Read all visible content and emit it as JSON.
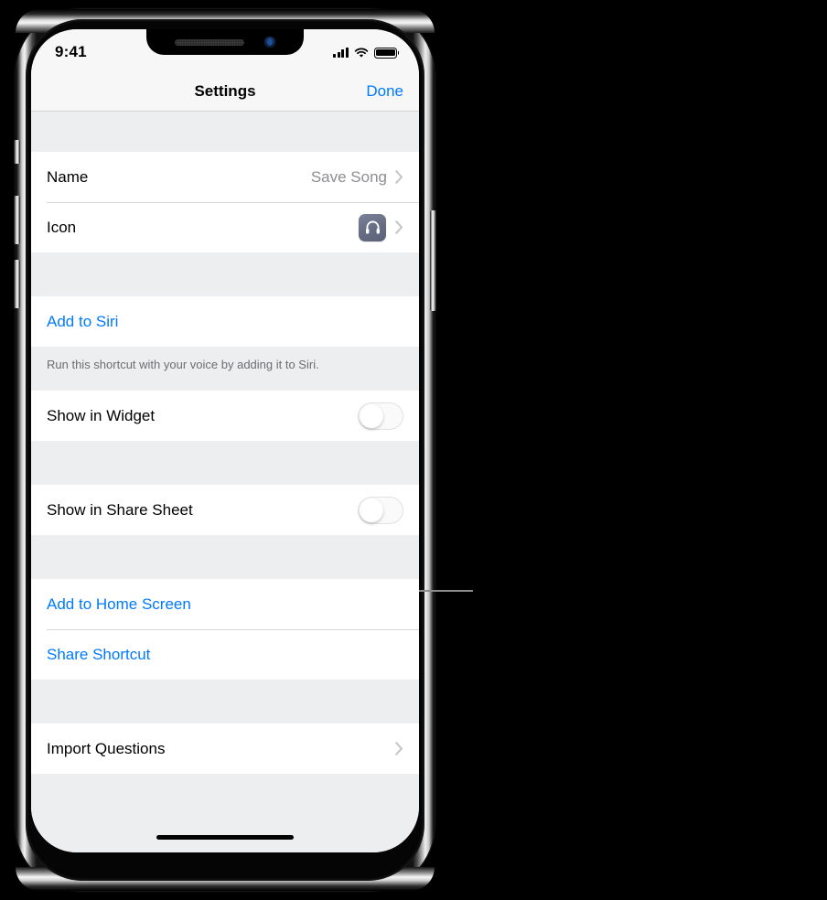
{
  "status_bar": {
    "time": "9:41",
    "signal_icon": "cellular-bars-icon",
    "wifi_icon": "wifi-icon",
    "battery_icon": "battery-full-icon"
  },
  "nav_bar": {
    "title": "Settings",
    "done_label": "Done"
  },
  "sections": [
    {
      "rows": [
        {
          "label": "Name",
          "value": "Save Song",
          "accessory": "chevron"
        },
        {
          "label": "Icon",
          "value": "",
          "accessory": "icon-chevron",
          "icon": "headphones-icon"
        }
      ]
    },
    {
      "rows": [
        {
          "label": "Add to Siri",
          "value": "",
          "accessory": "none",
          "style": "link"
        }
      ],
      "footer": "Run this shortcut with your voice by adding it to Siri."
    },
    {
      "rows": [
        {
          "label": "Show in Widget",
          "value": "",
          "accessory": "toggle",
          "toggle_on": false
        }
      ]
    },
    {
      "rows": [
        {
          "label": "Show in Share Sheet",
          "value": "",
          "accessory": "toggle",
          "toggle_on": false
        }
      ]
    },
    {
      "rows": [
        {
          "label": "Add to Home Screen",
          "value": "",
          "accessory": "none",
          "style": "link"
        },
        {
          "label": "Share Shortcut",
          "value": "",
          "accessory": "none",
          "style": "link"
        }
      ]
    },
    {
      "rows": [
        {
          "label": "Import Questions",
          "value": "",
          "accessory": "chevron"
        }
      ]
    }
  ],
  "device": {
    "speaker_icon": "speaker-grille-icon",
    "camera_icon": "front-camera-icon",
    "home_indicator": "home-indicator",
    "buttons": {
      "ringer": "ringer-switch",
      "volume_up": "volume-up-button",
      "volume_down": "volume-down-button",
      "power": "power-button"
    }
  },
  "colors": {
    "accent": "#007aff",
    "background": "#eceef0",
    "row": "#ffffff",
    "secondary_text": "#8e8e93",
    "icon_tile": "#6b7185"
  }
}
